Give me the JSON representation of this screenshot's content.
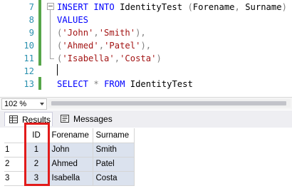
{
  "editor": {
    "lines": [
      {
        "num": "7",
        "segments": [
          {
            "text": "INSERT INTO ",
            "cls": "kw"
          },
          {
            "text": "IdentityTest ",
            "cls": ""
          },
          {
            "text": "(",
            "cls": "gray"
          },
          {
            "text": "Forename",
            "cls": ""
          },
          {
            "text": ", ",
            "cls": "gray"
          },
          {
            "text": "Surname",
            "cls": ""
          },
          {
            "text": ")",
            "cls": "gray"
          }
        ]
      },
      {
        "num": "8",
        "segments": [
          {
            "text": "VALUES",
            "cls": "kw"
          }
        ]
      },
      {
        "num": "9",
        "segments": [
          {
            "text": "(",
            "cls": "gray"
          },
          {
            "text": "'John'",
            "cls": "str"
          },
          {
            "text": ",",
            "cls": "gray"
          },
          {
            "text": "'Smith'",
            "cls": "str"
          },
          {
            "text": "),",
            "cls": "gray"
          }
        ]
      },
      {
        "num": "10",
        "segments": [
          {
            "text": "(",
            "cls": "gray"
          },
          {
            "text": "'Ahmed'",
            "cls": "str"
          },
          {
            "text": ",",
            "cls": "gray"
          },
          {
            "text": "'Patel'",
            "cls": "str"
          },
          {
            "text": "),",
            "cls": "gray"
          }
        ]
      },
      {
        "num": "11",
        "segments": [
          {
            "text": "(",
            "cls": "gray"
          },
          {
            "text": "'Isabella'",
            "cls": "str"
          },
          {
            "text": ",",
            "cls": "gray"
          },
          {
            "text": "'Costa'",
            "cls": "str"
          },
          {
            "text": ")",
            "cls": "gray"
          }
        ]
      },
      {
        "num": "12",
        "segments": []
      },
      {
        "num": "13",
        "segments": [
          {
            "text": "SELECT ",
            "cls": "kw"
          },
          {
            "text": "* ",
            "cls": "gray"
          },
          {
            "text": "FROM ",
            "cls": "kw"
          },
          {
            "text": "IdentityTest",
            "cls": ""
          }
        ]
      }
    ]
  },
  "zoom": {
    "value": "102 %"
  },
  "tabs": {
    "results_label": "Results",
    "messages_label": "Messages"
  },
  "grid": {
    "columns": [
      "ID",
      "Forename",
      "Surname"
    ],
    "rows": [
      {
        "rownum": "1",
        "cells": [
          "1",
          "John",
          "Smith"
        ]
      },
      {
        "rownum": "2",
        "cells": [
          "2",
          "Ahmed",
          "Patel"
        ]
      },
      {
        "rownum": "3",
        "cells": [
          "3",
          "Isabella",
          "Costa"
        ]
      }
    ]
  },
  "colors": {
    "keyword": "#0000ff",
    "string": "#a31515",
    "line_number": "#2b91af",
    "change_bar": "#57a64a",
    "highlight": "#e21b1b",
    "selected_cell": "#dbe2ee"
  }
}
